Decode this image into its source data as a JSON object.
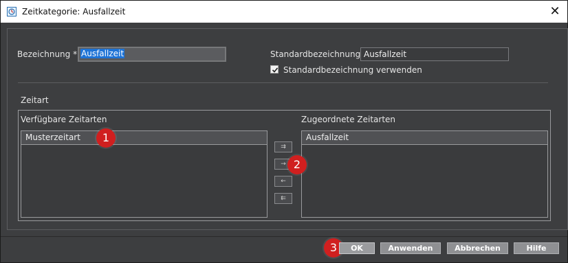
{
  "window": {
    "title": "Zeitkategorie: Ausfallzeit",
    "close_glyph": "✕",
    "app_icon": "time-category-icon"
  },
  "form": {
    "bezeichnung_label": "Bezeichnung *",
    "bezeichnung_value": "Ausfallzeit",
    "standard_label": "Standardbezeichnung",
    "standard_value": "Ausfallzeit",
    "use_standard_label": "Standardbezeichnung verwenden",
    "use_standard_checked": true
  },
  "zeitart": {
    "section_label": "Zeitart",
    "available": {
      "title": "Verfügbare Zeitarten",
      "items": [
        "Musterzeitart"
      ]
    },
    "assigned": {
      "title": "Zugeordnete Zeitarten",
      "items": [
        "Ausfallzeit"
      ]
    },
    "move_buttons": [
      {
        "glyph": "⇉",
        "icon": "move-all-right-icon"
      },
      {
        "glyph": "→",
        "icon": "move-right-icon"
      },
      {
        "glyph": "←",
        "icon": "move-left-icon"
      },
      {
        "glyph": "⇇",
        "icon": "move-all-left-icon"
      }
    ]
  },
  "annotations": [
    "1",
    "2",
    "3"
  ],
  "footer": {
    "ok": "OK",
    "apply": "Anwenden",
    "cancel": "Abbrechen",
    "help": "Hilfe"
  },
  "colors": {
    "background": "#3d3e40",
    "selection": "#1e73d6",
    "badge": "#d01f1f",
    "button": "#8f9093"
  }
}
